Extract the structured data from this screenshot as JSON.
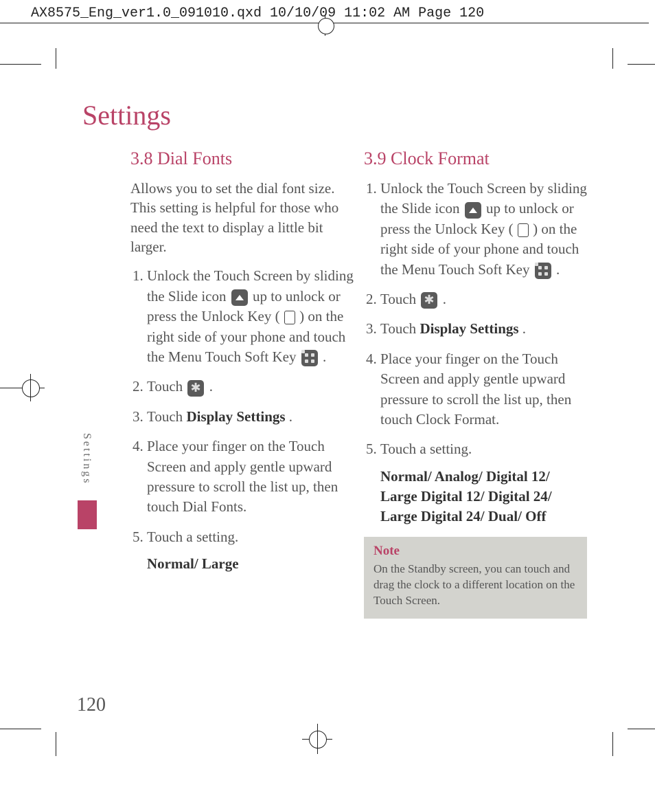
{
  "meta_header": "AX8575_Eng_ver1.0_091010.qxd  10/10/09  11:02 AM  Page 120",
  "section_title": "Settings",
  "side_tab": "Settings",
  "page_number": "120",
  "left": {
    "heading": "3.8 Dial Fonts",
    "desc": "Allows you to set the dial font size. This setting is helpful for those who need the text to display a little bit larger.",
    "steps": {
      "s1a": "Unlock the Touch Screen by sliding the Slide icon ",
      "s1b": " up to unlock or press the Unlock Key ( ",
      "s1c": " ) on the right side of your phone and touch the Menu Touch Soft Key ",
      "s1d": " .",
      "s2a": "Touch ",
      "s2b": " .",
      "s3a": "Touch ",
      "s3b": "Display Settings",
      "s3c": ".",
      "s4": "Place your finger on the Touch Screen and apply gentle upward pressure to scroll the list up, then touch Dial Fonts.",
      "s5": "Touch a setting.",
      "s5opts": "Normal/ Large"
    }
  },
  "right": {
    "heading": "3.9 Clock Format",
    "steps": {
      "s1a": "Unlock the Touch Screen by sliding the Slide icon ",
      "s1b": " up to unlock or press the Unlock Key ( ",
      "s1c": " ) on the right side of your phone and touch the Menu Touch Soft Key ",
      "s1d": " .",
      "s2a": "Touch ",
      "s2b": " .",
      "s3a": "Touch ",
      "s3b": "Display Settings",
      "s3c": ".",
      "s4": "Place your finger on the Touch Screen and apply gentle upward pressure to scroll the list up, then touch Clock Format.",
      "s5": "Touch a setting.",
      "s5opts": "Normal/ Analog/ Digital 12/ Large Digital 12/ Digital 24/ Large Digital 24/ Dual/ Off"
    },
    "note_title": "Note",
    "note_text": "On the Standby screen, you can touch and drag the clock to a different location on the Touch Screen."
  }
}
